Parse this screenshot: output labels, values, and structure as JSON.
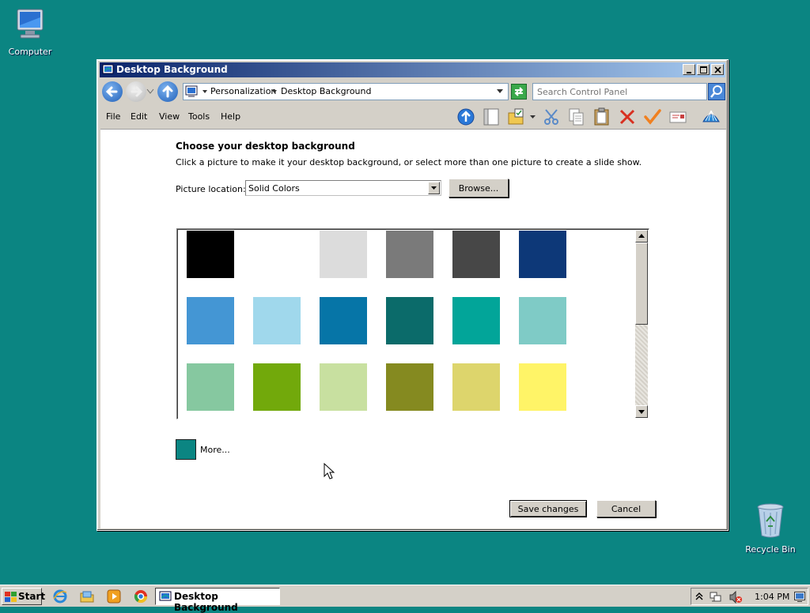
{
  "desktop": {
    "computer_label": "Computer",
    "recycle_label": "Recycle Bin",
    "background_color": "#0b8582"
  },
  "window": {
    "title": "Desktop Background",
    "address": {
      "crumb1": "Personalization",
      "crumb2": "Desktop Background"
    },
    "search_placeholder": "Search Control Panel",
    "menu": [
      "File",
      "Edit",
      "View",
      "Tools",
      "Help"
    ],
    "toolbar_icons": [
      "up-arrow-icon",
      "pane-icon",
      "folder-options-icon",
      "cut-icon",
      "copy-icon",
      "paste-icon",
      "delete-icon",
      "check-icon",
      "properties-icon",
      "help-icon"
    ],
    "heading": "Choose your desktop background",
    "subtext": "Click a picture to make it your desktop background, or select more than one picture to create a slide show.",
    "location_label": "Picture location:",
    "location_value": "Solid Colors",
    "browse_label": "Browse...",
    "swatches": [
      "#000000",
      "#ffffff",
      "#dcdcdc",
      "#7a7a7a",
      "#474747",
      "#0d3878",
      "#4496d4",
      "#a0d8ec",
      "#0675a7",
      "#0b6b6a",
      "#02a599",
      "#7fcbc6",
      "#86c8a0",
      "#72a90b",
      "#c8e0a0",
      "#858a20",
      "#ddd56c",
      "#fff467"
    ],
    "more_color": "#0b8582",
    "more_label": "More...",
    "save_label": "Save changes",
    "cancel_label": "Cancel"
  },
  "taskbar": {
    "start_label": "Start",
    "task_label": "Desktop Background",
    "clock": "1:04 PM"
  }
}
